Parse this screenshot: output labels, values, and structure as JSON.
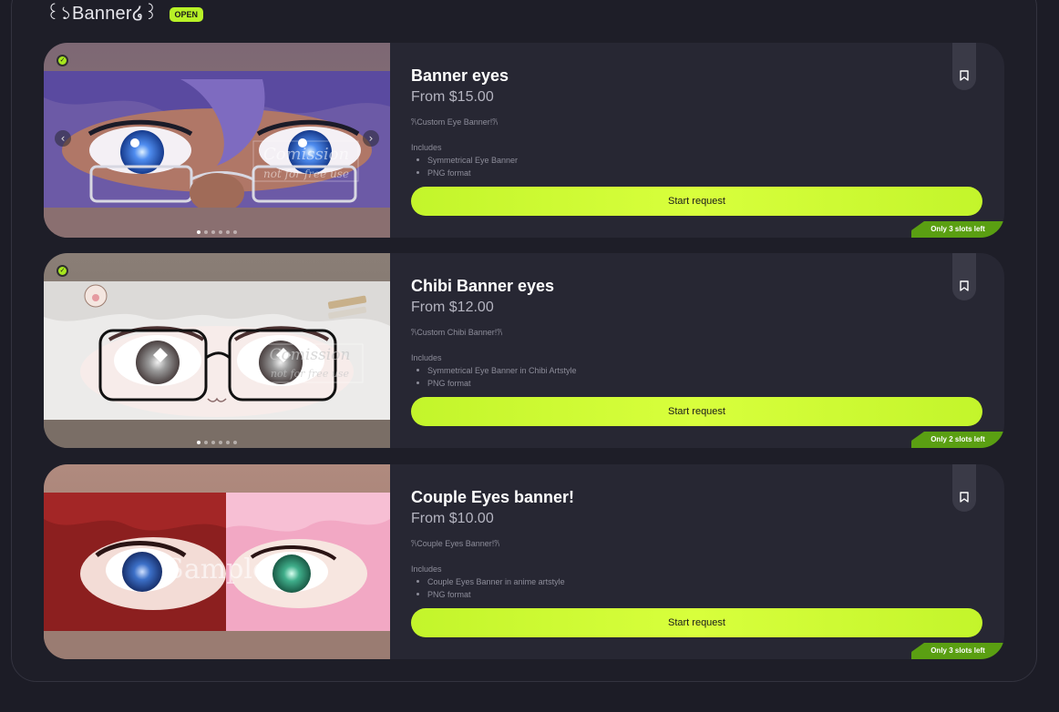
{
  "section": {
    "title": "꒰১Banner໒꒱",
    "status_badge": "OPEN"
  },
  "colors": {
    "accent": "#c3f52b",
    "card_bg": "#272733",
    "page_bg": "#1c1c26",
    "slots_badge": "#5a9f12"
  },
  "icons": {
    "bookmark": "bookmark-icon",
    "verified": "verified-check-icon",
    "prev": "chevron-left-icon",
    "next": "chevron-right-icon"
  },
  "listings": [
    {
      "title": "Banner eyes",
      "price": "From $15.00",
      "tagline": "𐙚Custom Eye Banner!𐙚",
      "includes_label": "Includes",
      "includes": [
        "Symmetrical Eye Banner",
        "PNG format"
      ],
      "button": "Start request",
      "slots": "Only 3 slots left",
      "watermark_line1": "Comission",
      "watermark_line2": "not for free use"
    },
    {
      "title": "Chibi Banner eyes",
      "price": "From $12.00",
      "tagline": "𐙚Custom Chibi Banner!𐙚",
      "includes_label": "Includes",
      "includes": [
        "Symmetrical Eye Banner in Chibi Artstyle",
        "PNG format"
      ],
      "button": "Start request",
      "slots": "Only 2 slots left",
      "watermark_line1": "Comission",
      "watermark_line2": "not for free use"
    },
    {
      "title": "Couple Eyes banner!",
      "price": "From $10.00",
      "tagline": "𐙚Couple Eyes Banner!𐙚",
      "includes_label": "Includes",
      "includes": [
        "Couple Eyes Banner in anime artstyle",
        "PNG format"
      ],
      "button": "Start request",
      "slots": "Only 3 slots left",
      "watermark_line1": "Sample"
    }
  ]
}
